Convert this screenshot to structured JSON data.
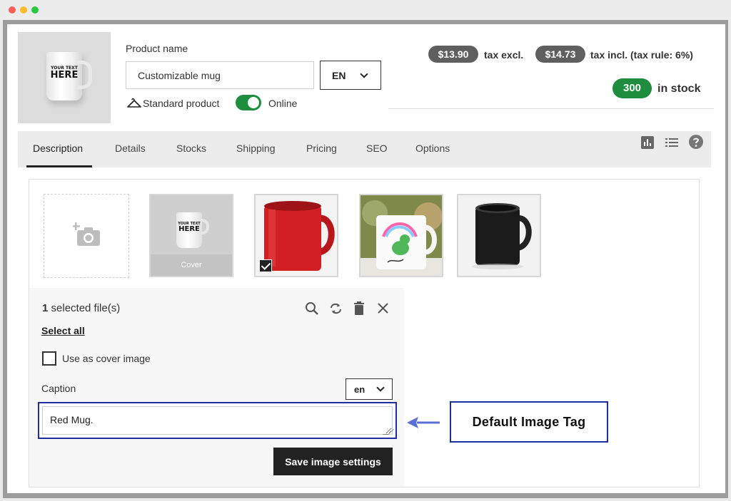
{
  "header": {
    "product_name_label": "Product name",
    "product_name_value": "Customizable mug",
    "language": "EN",
    "product_type": "Standard product",
    "online_label": "Online",
    "online_enabled": true,
    "mug_print_line1": "YOUR TEXT",
    "mug_print_line2": "HERE"
  },
  "pricing": {
    "price_excl": "$13.90",
    "price_excl_label": "tax excl.",
    "price_incl": "$14.73",
    "price_incl_label": "tax incl. (tax rule: 6%)",
    "stock": "300",
    "stock_label": "in stock"
  },
  "tabs": [
    {
      "label": "Description"
    },
    {
      "label": "Details"
    },
    {
      "label": "Stocks"
    },
    {
      "label": "Shipping"
    },
    {
      "label": "Pricing"
    },
    {
      "label": "SEO"
    },
    {
      "label": "Options"
    }
  ],
  "images": {
    "cover_label": "Cover"
  },
  "image_settings": {
    "selected_count": "1",
    "selected_text": "selected file(s)",
    "select_all": "Select all",
    "use_as_cover": "Use as cover image",
    "caption_label": "Caption",
    "caption_language": "en",
    "caption_value": "Red Mug.",
    "save_label": "Save image settings"
  },
  "annotation": {
    "callout": "Default Image Tag"
  },
  "colors": {
    "accent_green": "#1e8e3e",
    "annotation_blue": "#1d2fa0",
    "dark": "#222222"
  }
}
